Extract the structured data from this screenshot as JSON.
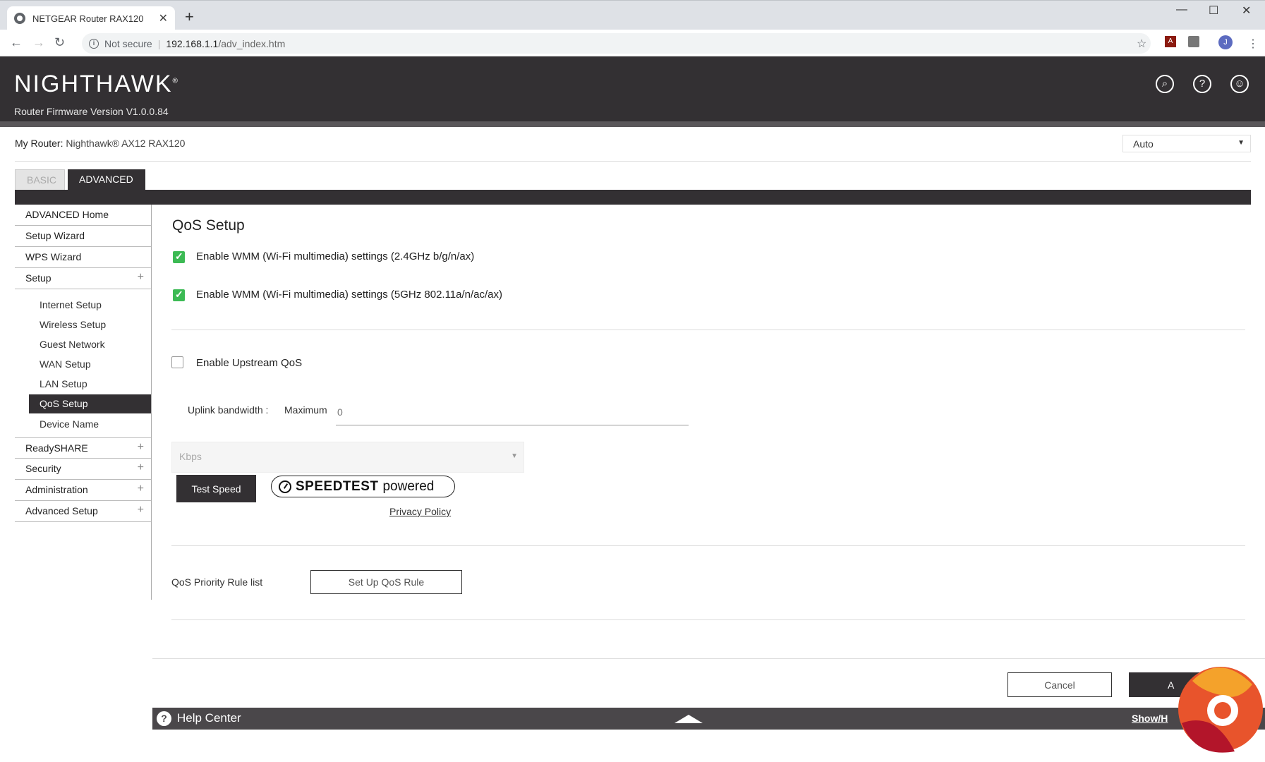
{
  "browser": {
    "tab_title": "NETGEAR Router RAX120",
    "new_tab": "+",
    "security_label": "Not secure",
    "url_host": "192.168.1.1",
    "url_path": "/adv_index.htm",
    "profile_initial": "J"
  },
  "header": {
    "logo": "NIGHTHAWK",
    "firmware": "Router Firmware Version V1.0.0.84"
  },
  "router": {
    "label": "My Router:",
    "name": "Nighthawk® AX12 RAX120",
    "lang_value": "Auto"
  },
  "tabs": {
    "basic": "BASIC",
    "advanced": "ADVANCED"
  },
  "sidebar": {
    "items": [
      "ADVANCED Home",
      "Setup Wizard",
      "WPS Wizard",
      "Setup"
    ],
    "setup_sub": [
      "Internet Setup",
      "Wireless Setup",
      "Guest Network",
      "WAN Setup",
      "LAN Setup",
      "QoS Setup",
      "Device Name"
    ],
    "bottom_items": [
      "ReadySHARE",
      "Security",
      "Administration",
      "Advanced Setup"
    ]
  },
  "main": {
    "title": "QoS Setup",
    "wmm24": {
      "label": "Enable WMM (Wi-Fi multimedia) settings (2.4GHz b/g/n/ax)",
      "checked": true
    },
    "wmm5": {
      "label": "Enable WMM (Wi-Fi multimedia) settings (5GHz 802.11a/n/ac/ax)",
      "checked": true
    },
    "upstream": {
      "label": "Enable Upstream QoS",
      "checked": false
    },
    "uplink_label": "Uplink bandwidth :",
    "maximum_label": "Maximum",
    "bandwidth_placeholder": "0",
    "unit_value": "Kbps",
    "test_speed": "Test Speed",
    "speedtest_brand": "SPEEDTEST",
    "speedtest_powered": "powered",
    "privacy": "Privacy Policy",
    "qos_rule_label": "QoS Priority Rule list",
    "qos_rule_button": "Set Up QoS Rule",
    "cancel": "Cancel",
    "apply": "A"
  },
  "help": {
    "title": "Help Center",
    "show_hide": "Show/H"
  },
  "colors": {
    "header_bg": "#333033",
    "check_green": "#3cba54"
  }
}
